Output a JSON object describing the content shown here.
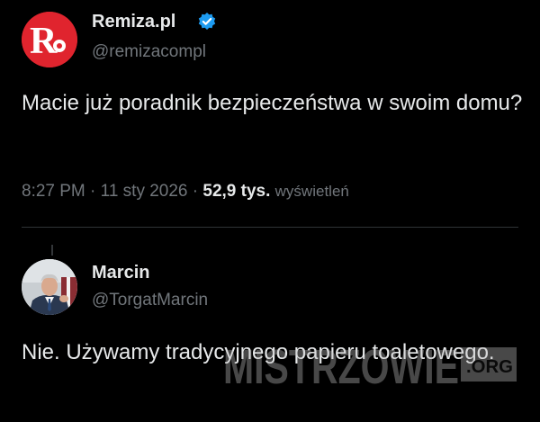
{
  "original_tweet": {
    "display_name": "Remiza.pl",
    "handle": "@remizacompl",
    "text": "Macie już poradnik bezpieczeństwa w swoim domu?",
    "time": "8:27 PM",
    "date": "11 sty 2026",
    "views_count": "52,9 tys.",
    "views_label": "wyświetleń",
    "verified": true,
    "avatar_icon": "remiza-logo-icon",
    "avatar_letter": "R"
  },
  "reply_tweet": {
    "display_name": "Marcin",
    "handle": "@TorgatMarcin",
    "text": "Nie. Używamy tradycyjnego papieru toaletowego.",
    "avatar_icon": "user-photo-avatar"
  },
  "watermark": {
    "text": "MISTRZOWIE",
    "suffix": ".ORG"
  },
  "colors": {
    "background": "#000000",
    "primary_text": "#e7e9ea",
    "secondary_text": "#71767b",
    "verified_badge": "#1d9bf0",
    "divider": "#2f3336",
    "remiza_red": "#e0242e"
  }
}
